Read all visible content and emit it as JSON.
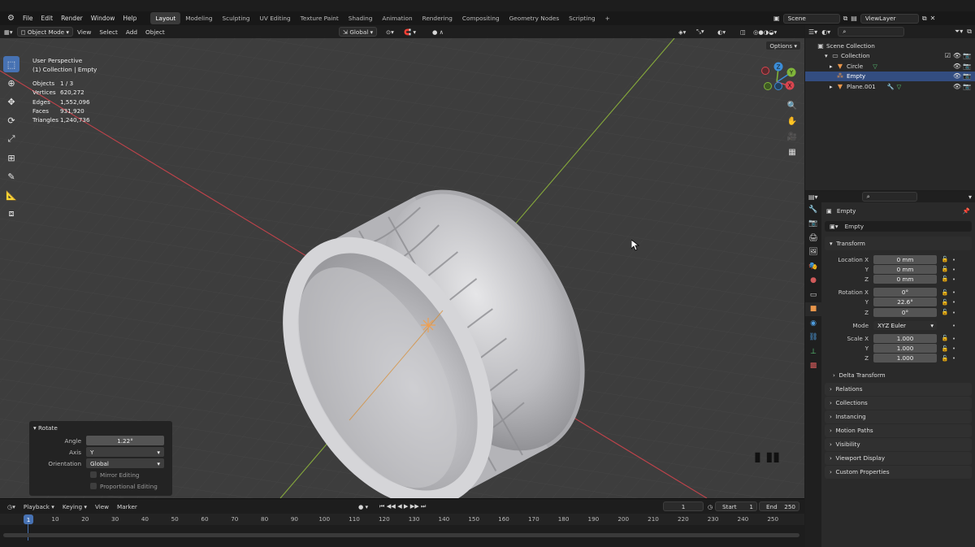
{
  "menu": [
    "File",
    "Edit",
    "Render",
    "Window",
    "Help"
  ],
  "workspaces": [
    "Layout",
    "Modeling",
    "Sculpting",
    "UV Editing",
    "Texture Paint",
    "Shading",
    "Animation",
    "Rendering",
    "Compositing",
    "Geometry Nodes",
    "Scripting",
    "+"
  ],
  "active_workspace": "Layout",
  "scene": "Scene",
  "view_layer": "ViewLayer",
  "viewport_header": {
    "mode": "Object Mode",
    "items": [
      "View",
      "Select",
      "Add",
      "Object"
    ],
    "orientation": "Global",
    "options": "Options"
  },
  "viewport_overlay": {
    "view_name": "User Perspective",
    "context": "(1) Collection | Empty"
  },
  "stats": [
    {
      "k": "Objects",
      "v": "1 / 3"
    },
    {
      "k": "Vertices",
      "v": "620,272"
    },
    {
      "k": "Edges",
      "v": "1,552,096"
    },
    {
      "k": "Faces",
      "v": "931,920"
    },
    {
      "k": "Triangles",
      "v": "1,240,736"
    }
  ],
  "gizmo_axes": {
    "x": "X",
    "y": "Y",
    "z": "Z"
  },
  "redo_panel": {
    "title": "Rotate",
    "angle_label": "Angle",
    "angle": "1.22°",
    "axis_label": "Axis",
    "axis": "Y",
    "orientation_label": "Orientation",
    "orientation": "Global",
    "mirror": "Mirror Editing",
    "proportional": "Proportional Editing"
  },
  "timeline": {
    "menus": [
      "Playback",
      "Keying",
      "View",
      "Marker"
    ],
    "current_frame": "1",
    "start_label": "Start",
    "start": "1",
    "end_label": "End",
    "end": "250",
    "ruler_current": "1",
    "ruler": [
      "10",
      "20",
      "30",
      "40",
      "50",
      "60",
      "70",
      "80",
      "90",
      "100",
      "110",
      "120",
      "130",
      "140",
      "150",
      "160",
      "170",
      "180",
      "190",
      "200",
      "210",
      "220",
      "230",
      "240",
      "250"
    ]
  },
  "outliner": {
    "scene_collection": "Scene Collection",
    "collection": "Collection",
    "items": [
      {
        "name": "Circle",
        "selected": false
      },
      {
        "name": "Empty",
        "selected": true
      },
      {
        "name": "Plane.001",
        "selected": false
      }
    ]
  },
  "properties": {
    "object_name": "Empty",
    "data_name": "Empty",
    "transform_label": "Transform",
    "location": {
      "label": "Location X",
      "x": "0 mm",
      "y": "0 mm",
      "z": "0 mm"
    },
    "rotation": {
      "label": "Rotation X",
      "x": "0°",
      "y": "22.6°",
      "z": "0°"
    },
    "mode_label": "Mode",
    "mode": "XYZ Euler",
    "scale": {
      "label": "Scale X",
      "x": "1.000",
      "y": "1.000",
      "z": "1.000"
    },
    "axis_y": "Y",
    "axis_z": "Z",
    "delta": "Delta Transform",
    "panels": [
      "Relations",
      "Collections",
      "Instancing",
      "Motion Paths",
      "Visibility",
      "Viewport Display",
      "Custom Properties"
    ]
  },
  "colors": {
    "accent": "#4772b3",
    "x_axis": "#d8454f",
    "y_axis": "#80b63a",
    "z_axis": "#3b8dd8",
    "object_orange": "#e9964b"
  }
}
